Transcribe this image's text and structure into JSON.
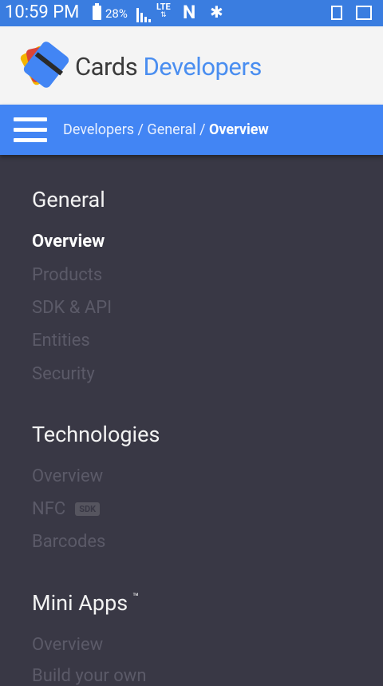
{
  "status_bar": {
    "time": "10:59 PM",
    "battery_pct": "28%",
    "network": "LTE",
    "network_arrows": "⇅",
    "nfc_glyph": "N",
    "bluetooth_glyph": "✱"
  },
  "header": {
    "brand_primary": "Cards",
    "brand_secondary": "Developers",
    "logo_colors": [
      "#f4b400",
      "#db4437",
      "#4285f4"
    ]
  },
  "breadcrumb": {
    "part1": "Developers / General / ",
    "current": "Overview"
  },
  "nav": {
    "sections": [
      {
        "title": "General",
        "items": [
          "Overview",
          "Products",
          "SDK & API",
          "Entities",
          "Security"
        ]
      },
      {
        "title": "Technologies",
        "items": [
          "Overview",
          "NFC",
          "Barcodes"
        ],
        "nfc_badge": "SDK"
      },
      {
        "title": "Mini Apps",
        "tm": "™",
        "items": [
          "Overview",
          "Build your own"
        ]
      }
    ]
  },
  "colors": {
    "status_bar": "#3a7de0",
    "header_bg": "#f4f4f4",
    "crumb_bar": "#4285f4",
    "nav_bg": "#393845",
    "nav_inactive": "#5b5a68"
  }
}
